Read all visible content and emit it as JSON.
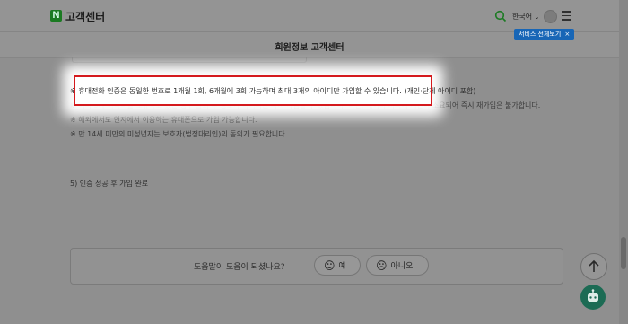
{
  "header": {
    "logo_letter": "N",
    "brand": "고객센터",
    "lang": "한국어",
    "service_button": "서비스 전체보기",
    "service_close": "×"
  },
  "subheader": {
    "title": "회원정보 고객센터"
  },
  "notes": {
    "highlighted": "※ 휴대전화 인증은 동일한 번호로 1개월 1회, 6개월에 3회 가능하며 최대 3개의 아이디만 가입할 수 있습니다. (개인·단체 아이디 포함)",
    "line2": "※ 이미 3개 아이디를 보유하고 있는 경우 탈퇴 후 정보가 파기되면 다시 가입할 수 있습니다. 다만, 데이터 처리에 시간이 소요되어 즉시 재가입은 불가합니다.",
    "line3": "※ 해외에서도 현지에서 이용하는 휴대폰으로 가입 가능합니다.",
    "line4": "※ 만 14세 미만의 미성년자는 보호자(법정대리인)의 동의가 필요합니다."
  },
  "step": "5) 인증 성공 후 가입 완료",
  "feedback": {
    "question": "도움말이 도움이 되셨나요?",
    "yes": "예",
    "no": "아니오"
  },
  "colors": {
    "highlight_border": "#d4191d",
    "service_button_bg": "#1866b6",
    "brand_green": "#1b7a22",
    "chatbot_bg": "#1c6b54"
  },
  "icons": [
    "search-icon",
    "chevron-down-icon",
    "user-icon",
    "menu-icon",
    "smile-icon",
    "frown-icon",
    "arrow-up-icon",
    "chatbot-icon"
  ]
}
